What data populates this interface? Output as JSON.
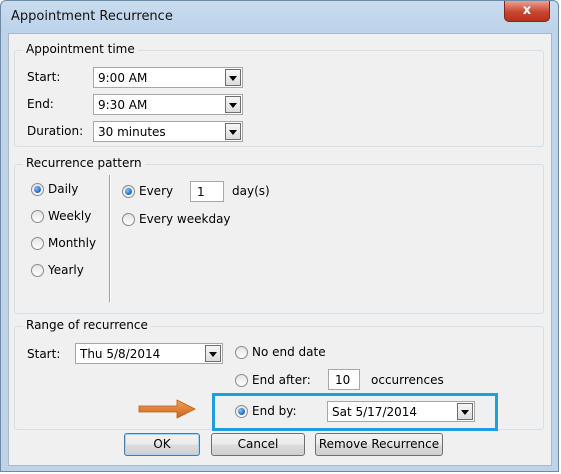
{
  "window": {
    "title": "Appointment Recurrence",
    "close_label": "x"
  },
  "appointment_time": {
    "legend": "Appointment time",
    "start_label": "Start:",
    "start_value": "9:00 AM",
    "end_label": "End:",
    "end_value": "9:30 AM",
    "duration_label": "Duration:",
    "duration_value": "30 minutes"
  },
  "recurrence_pattern": {
    "legend": "Recurrence pattern",
    "frequencies": [
      {
        "label": "Daily",
        "selected": true
      },
      {
        "label": "Weekly",
        "selected": false
      },
      {
        "label": "Monthly",
        "selected": false
      },
      {
        "label": "Yearly",
        "selected": false
      }
    ],
    "every_label": "Every",
    "every_value": "1",
    "every_unit": "day(s)",
    "every_weekday_label": "Every weekday"
  },
  "range": {
    "legend": "Range of recurrence",
    "start_label": "Start:",
    "start_value": "Thu 5/8/2014",
    "no_end_label": "No end date",
    "end_after_label": "End after:",
    "occurrences_value": "10",
    "occurrences_label": "occurrences",
    "end_by_label": "End by:",
    "end_by_value": "Sat 5/17/2014",
    "highlight_color": "#1aa0dc",
    "arrow_color": "#e07a22"
  },
  "buttons": {
    "ok": "OK",
    "cancel": "Cancel",
    "remove": "Remove Recurrence"
  }
}
